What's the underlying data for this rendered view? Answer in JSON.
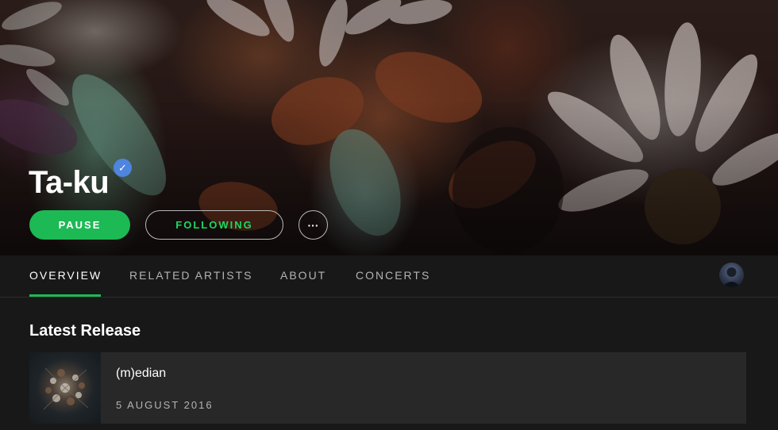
{
  "artist": {
    "name": "Ta-ku",
    "verified_icon": "verified-check-icon"
  },
  "actions": {
    "pause_label": "PAUSE",
    "following_label": "FOLLOWING",
    "more_label": "···"
  },
  "tabs": [
    {
      "label": "OVERVIEW",
      "active": true
    },
    {
      "label": "RELATED ARTISTS",
      "active": false
    },
    {
      "label": "ABOUT",
      "active": false
    },
    {
      "label": "CONCERTS",
      "active": false
    }
  ],
  "latest_release": {
    "section_title": "Latest Release",
    "title": "(m)edian",
    "date": "5 AUGUST 2016"
  },
  "colors": {
    "accent": "#1db954",
    "verified": "#4e85de",
    "background": "#181818",
    "card": "#282828"
  }
}
